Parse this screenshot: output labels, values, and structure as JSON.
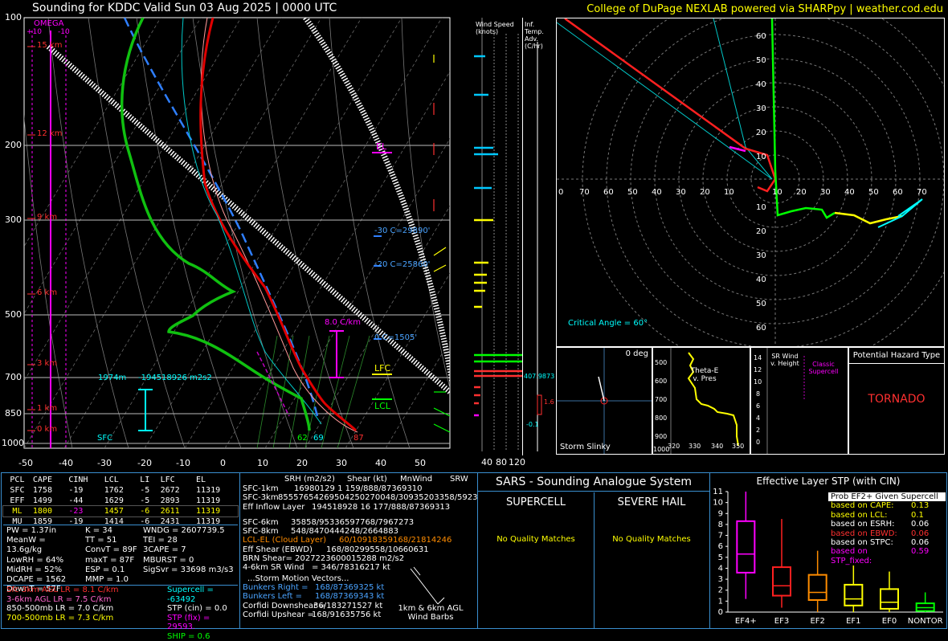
{
  "header": {
    "title": "Sounding for KDDC Valid  Sun 03 Aug 2025 | 0000 UTC",
    "credit": "College of DuPage NEXLAB powered via SHARPpy | weather.cod.edu"
  },
  "skewt": {
    "pressure_labels": [
      "100",
      "200",
      "300",
      "500",
      "700",
      "850",
      "1000"
    ],
    "temp_labels": [
      "-50",
      "-40",
      "-30",
      "-20",
      "-10",
      "0",
      "10",
      "20",
      "30",
      "40",
      "50"
    ],
    "height_labels": [
      "15 km",
      "12 km",
      "9 km",
      "6 km",
      "3 km",
      "1 km",
      "0 km"
    ],
    "omega_label": "OMEGA",
    "omega_scale": "+10       -10",
    "el_label": "EL",
    "lfc_label": "LFC",
    "lcl_label": "LCL",
    "lapse_label": "8.0 C/km",
    "isotherm_labels": [
      "-30 C=29890'",
      "-20 C=25860'",
      "0 C=1505'"
    ],
    "eff_inflow_label": "1974m",
    "eff_srh_label": "-194518926 m2s2",
    "sfc_label": "SFC",
    "sfc_t": "87",
    "sfc_td": "62",
    "sfc_tw": "69",
    "mixing_ratios": [
      "2",
      "5",
      "10",
      "13",
      "22",
      "25",
      "30",
      "34"
    ]
  },
  "windspeed": {
    "title": "Wind Speed (knots)",
    "ticks": [
      "40",
      "80",
      "120"
    ]
  },
  "infladv": {
    "title": "Inf. Temp. Adv. (C/hr)",
    "val1": "407.9873",
    "val2": "1.6",
    "val3": "-0.1"
  },
  "hodograph": {
    "rings_top": [
      "60",
      "50",
      "40",
      "30",
      "20",
      "10"
    ],
    "rings_bottom": [
      "10",
      "20",
      "30",
      "40",
      "50",
      "60"
    ],
    "axis_left": [
      "70",
      "60",
      "50",
      "40",
      "30",
      "20",
      "10"
    ],
    "axis_center": "0",
    "axis_right": [
      "10",
      "20",
      "30",
      "40",
      "50",
      "60",
      "70"
    ],
    "critical_angle": "Critical Angle = 60°"
  },
  "slinky": {
    "deg": "0 deg",
    "label": "Storm Slinky"
  },
  "thetae": {
    "title": "Theta-E v. Pres",
    "y_ticks": [
      "500",
      "600",
      "700",
      "800",
      "900"
    ],
    "x_ticks": [
      "320",
      "330",
      "340",
      "350"
    ],
    "corner": "1000"
  },
  "srwind": {
    "title": "SR Wind v. Height",
    "sub": "Classic Supercell",
    "y_ticks": [
      "14",
      "12",
      "10",
      "8",
      "6",
      "4",
      "2",
      "0"
    ]
  },
  "hazard": {
    "title": "Potential Hazard Type",
    "value": "TORNADO"
  },
  "parcels": {
    "headers": [
      "PCL",
      "CAPE",
      "CINH",
      "LCL",
      "LI",
      "LFC",
      "EL"
    ],
    "rows": [
      [
        "SFC",
        "1758",
        "-19",
        "1762",
        "-5",
        "2672",
        "11319"
      ],
      [
        "EFF",
        "1499",
        "-44",
        "1629",
        "-5",
        "2893",
        "11319"
      ],
      [
        "ML",
        "1800",
        "-23",
        "1457",
        "-6",
        "2611",
        "11319"
      ],
      [
        "MU",
        "1859",
        "-19",
        "1414",
        "-6",
        "2431",
        "11319"
      ]
    ]
  },
  "indices": {
    "col1": [
      "PW = 1.37in",
      "MeanW = 13.6g/kg",
      "LowRH = 64%",
      "MidRH = 52%",
      "DCAPE = 1562",
      "DownT = 57F"
    ],
    "col2": [
      "K = 34",
      "TT = 51",
      "ConvT = 89F",
      "maxT = 87F",
      "ESP = 0.1",
      "MMP = 1.0"
    ],
    "col3": [
      "WNDG = 2607739.5",
      "TEI = 28",
      "3CAPE = 7",
      "MBURST = 0",
      "",
      "SigSvr = 33698 m3/s3"
    ]
  },
  "lapse": [
    {
      "t": "Sfc-3km AGL LR = 8.1 C/km",
      "c": "r"
    },
    {
      "t": "3-6km AGL LR = 7.5 C/km",
      "c": "pk"
    },
    {
      "t": "850-500mb LR = 7.0 C/km",
      "c": "w"
    },
    {
      "t": "700-500mb LR = 7.3 C/km",
      "c": "y"
    }
  ],
  "composite": [
    {
      "t": "Supercell = -63492",
      "c": "c"
    },
    {
      "t": "STP (cin) = 0.0",
      "c": "w"
    },
    {
      "t": "STP (fix) = 29593.",
      "c": "m"
    },
    {
      "t": "SHIP = 0.6",
      "c": "g"
    }
  ],
  "kinematics": {
    "headers": [
      "SRH (m2/s2)",
      "Shear (kt)",
      "MnWind",
      "SRW"
    ],
    "rows": [
      {
        "l": "SFC-1km",
        "v": "16980129              1     159/888/87369310",
        "c": "w"
      },
      {
        "l": "SFC-3km",
        "v": "85557654269504250270048/30935203358/59230954",
        "c": "w"
      },
      {
        "l": "Eff Inflow Layer",
        "v": "194518928           16     177/888/87369313",
        "c": "w"
      },
      {
        "l": "",
        "v": "",
        "c": "w"
      },
      {
        "l": "SFC-6km",
        "v": "35858/95336597768/7967273",
        "c": "w"
      },
      {
        "l": "SFC-8km",
        "v": "548/8470444248/2664883",
        "c": "w"
      },
      {
        "l": "LCL-EL (Cloud Layer)",
        "v": "60/10918359168/21814246",
        "c": "o"
      },
      {
        "l": "Eff Shear (EBWD)",
        "v": "168/80299558/10660631",
        "c": "w"
      },
      {
        "l": "BRN Shear",
        "v": "= 2027223600015288 m2/s2",
        "c": "w"
      },
      {
        "l": "4-6km SR Wind",
        "v": "=  346/78316217 kt",
        "c": "w"
      }
    ],
    "storm_title": "...Storm Motion Vectors...",
    "storm": [
      {
        "l": "Bunkers Right =",
        "v": "168/87369325 kt",
        "c": "lb"
      },
      {
        "l": "Bunkers Left =",
        "v": "168/87369343 kt",
        "c": "lb"
      },
      {
        "l": "Corfidi Downshear =",
        "v": "36/183271527 kt",
        "c": "w"
      },
      {
        "l": "Corfidi Upshear =",
        "v": "168/91635756 kt",
        "c": "w"
      }
    ],
    "barbs_label": "1km & 6km AGL Wind Barbs"
  },
  "sars": {
    "title": "SARS - Sounding Analogue System",
    "supercell": "SUPERCELL",
    "hail": "SEVERE HAIL",
    "nomatch": "No Quality Matches"
  },
  "stp": {
    "title": "Effective Layer STP (with CIN)",
    "y_ticks": [
      "11",
      "10",
      "9",
      "8",
      "7",
      "6",
      "5",
      "4",
      "3",
      "2",
      "1",
      "0"
    ],
    "categories": [
      "EF4+",
      "EF3",
      "EF2",
      "EF1",
      "EF0",
      "NONTOR"
    ],
    "prob_title": "Prob EF2+ Given Supercell",
    "prob": [
      {
        "l": "based on CAPE:",
        "v": "0.13",
        "c": "y"
      },
      {
        "l": "based on LCL:",
        "v": "0.1",
        "c": "y"
      },
      {
        "l": "based on ESRH:",
        "v": "0.06",
        "c": "w"
      },
      {
        "l": "based on EBWD:",
        "v": "0.06",
        "c": "r"
      },
      {
        "l": "based on STPC:",
        "v": "0.06",
        "c": "w"
      },
      {
        "l": "based on STP_fixed:",
        "v": "0.59",
        "c": "m"
      }
    ]
  },
  "chart_data": {
    "type": "box",
    "title": "Effective Layer STP (with CIN)",
    "categories": [
      "EF4+",
      "EF3",
      "EF2",
      "EF1",
      "EF0",
      "NONTOR"
    ],
    "ylim": [
      0,
      11
    ],
    "boxes": [
      {
        "min": 1.2,
        "q1": 3.6,
        "med": 5.3,
        "q3": 8.3,
        "max": 11.0,
        "color": "#ff00ff"
      },
      {
        "min": 0.4,
        "q1": 1.5,
        "med": 2.4,
        "q3": 4.1,
        "max": 8.5,
        "color": "#ff2020"
      },
      {
        "min": 0.0,
        "q1": 1.1,
        "med": 1.8,
        "q3": 3.4,
        "max": 5.6,
        "color": "#ff8c00"
      },
      {
        "min": 0.0,
        "q1": 0.6,
        "med": 1.2,
        "q3": 2.5,
        "max": 4.5,
        "color": "#ffff00"
      },
      {
        "min": 0.0,
        "q1": 0.3,
        "med": 0.9,
        "q3": 2.1,
        "max": 3.7,
        "color": "#ffff00"
      },
      {
        "min": 0.0,
        "q1": 0.1,
        "med": 0.4,
        "q3": 0.8,
        "max": 1.8,
        "color": "#00ff00"
      }
    ]
  }
}
